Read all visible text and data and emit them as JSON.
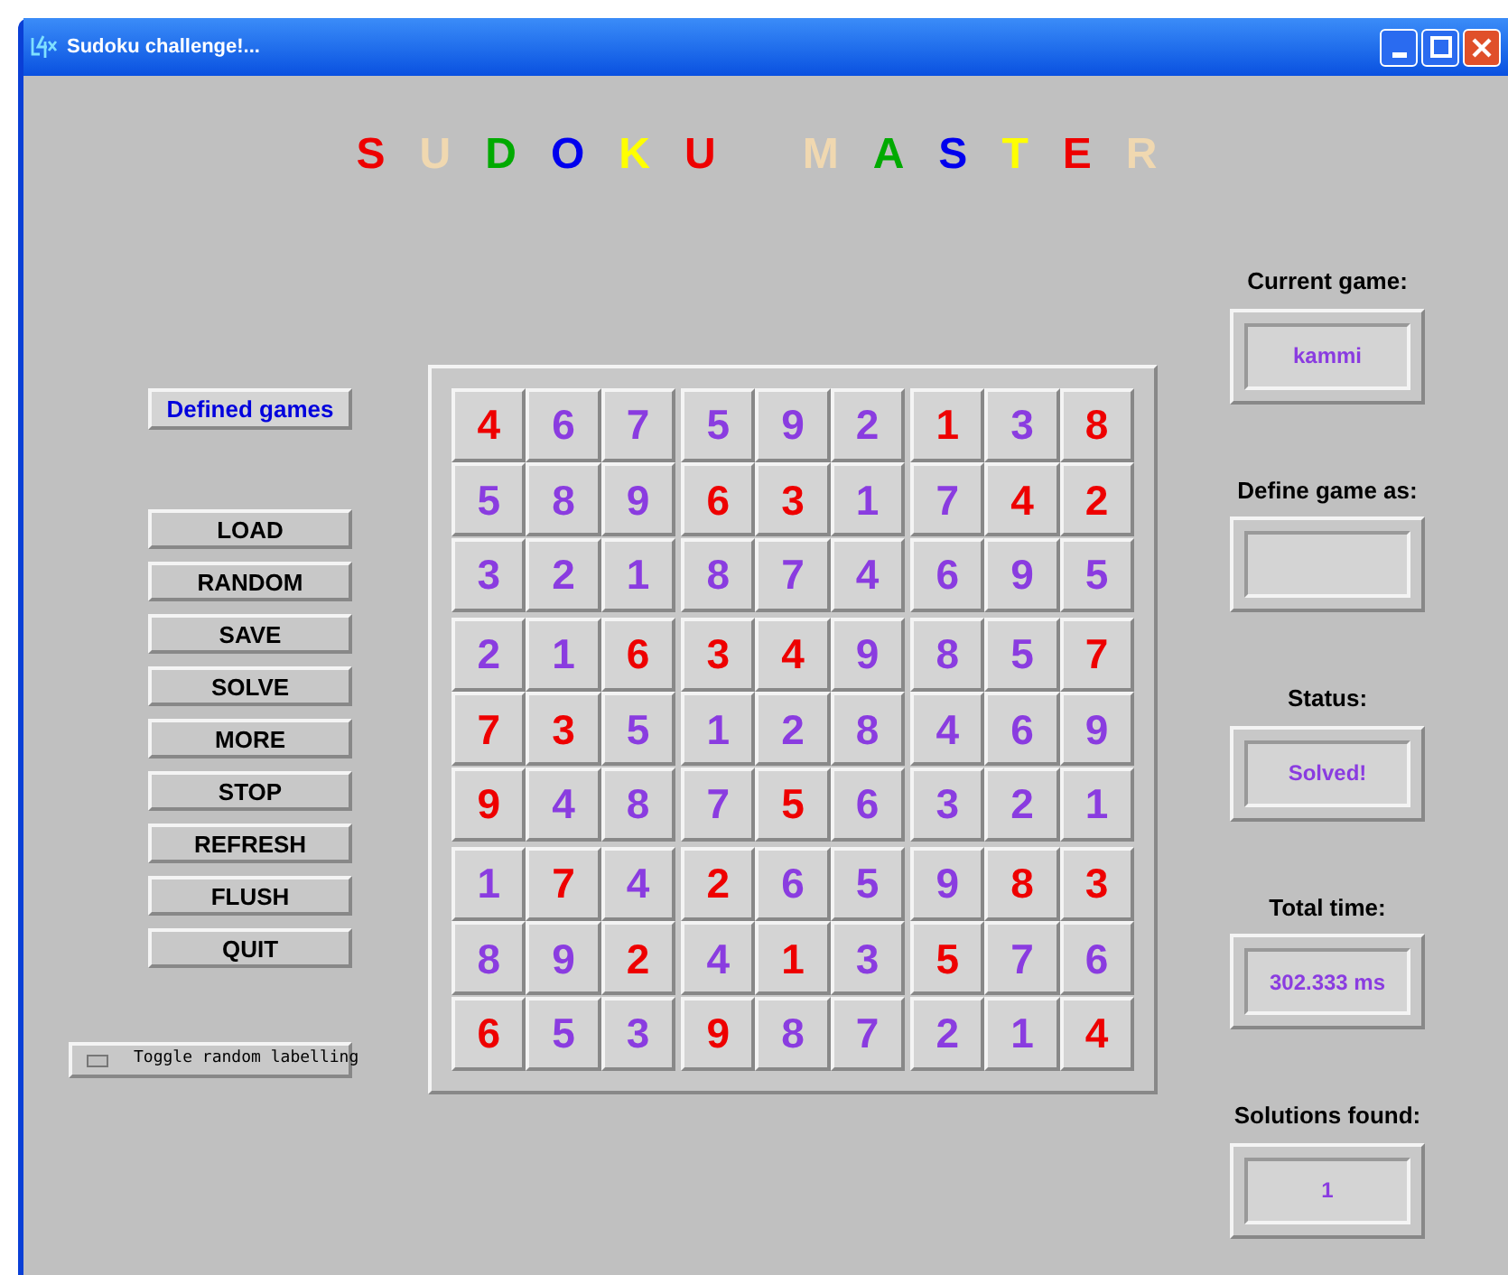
{
  "window": {
    "title": "Sudoku challenge!..."
  },
  "banner": {
    "words": [
      [
        {
          "letter": "S",
          "color": "#ee0000"
        },
        {
          "letter": "U",
          "color": "#f0d8b0"
        },
        {
          "letter": "D",
          "color": "#00aa00"
        },
        {
          "letter": "O",
          "color": "#0000ee"
        },
        {
          "letter": "K",
          "color": "#ffff00"
        },
        {
          "letter": "U",
          "color": "#ee0000"
        }
      ],
      [
        {
          "letter": "M",
          "color": "#f0d8b0"
        },
        {
          "letter": "A",
          "color": "#00aa00"
        },
        {
          "letter": "S",
          "color": "#0000ee"
        },
        {
          "letter": "T",
          "color": "#ffff00"
        },
        {
          "letter": "E",
          "color": "#ee0000"
        },
        {
          "letter": "R",
          "color": "#f0d8b0"
        }
      ]
    ]
  },
  "defined_games_button": "Defined games",
  "buttons": [
    "LOAD",
    "RANDOM",
    "SAVE",
    "SOLVE",
    "MORE",
    "STOP",
    "REFRESH",
    "FLUSH",
    "QUIT"
  ],
  "toggle": {
    "label": "Toggle random labelling",
    "checked": false
  },
  "grid": [
    [
      {
        "value": "4",
        "given": true
      },
      {
        "value": "6",
        "given": false
      },
      {
        "value": "7",
        "given": false
      },
      {
        "value": "5",
        "given": false
      },
      {
        "value": "9",
        "given": false
      },
      {
        "value": "2",
        "given": false
      },
      {
        "value": "1",
        "given": true
      },
      {
        "value": "3",
        "given": false
      },
      {
        "value": "8",
        "given": true
      }
    ],
    [
      {
        "value": "5",
        "given": false
      },
      {
        "value": "8",
        "given": false
      },
      {
        "value": "9",
        "given": false
      },
      {
        "value": "6",
        "given": true
      },
      {
        "value": "3",
        "given": true
      },
      {
        "value": "1",
        "given": false
      },
      {
        "value": "7",
        "given": false
      },
      {
        "value": "4",
        "given": true
      },
      {
        "value": "2",
        "given": true
      }
    ],
    [
      {
        "value": "3",
        "given": false
      },
      {
        "value": "2",
        "given": false
      },
      {
        "value": "1",
        "given": false
      },
      {
        "value": "8",
        "given": false
      },
      {
        "value": "7",
        "given": false
      },
      {
        "value": "4",
        "given": false
      },
      {
        "value": "6",
        "given": false
      },
      {
        "value": "9",
        "given": false
      },
      {
        "value": "5",
        "given": false
      }
    ],
    [
      {
        "value": "2",
        "given": false
      },
      {
        "value": "1",
        "given": false
      },
      {
        "value": "6",
        "given": true
      },
      {
        "value": "3",
        "given": true
      },
      {
        "value": "4",
        "given": true
      },
      {
        "value": "9",
        "given": false
      },
      {
        "value": "8",
        "given": false
      },
      {
        "value": "5",
        "given": false
      },
      {
        "value": "7",
        "given": true
      }
    ],
    [
      {
        "value": "7",
        "given": true
      },
      {
        "value": "3",
        "given": true
      },
      {
        "value": "5",
        "given": false
      },
      {
        "value": "1",
        "given": false
      },
      {
        "value": "2",
        "given": false
      },
      {
        "value": "8",
        "given": false
      },
      {
        "value": "4",
        "given": false
      },
      {
        "value": "6",
        "given": false
      },
      {
        "value": "9",
        "given": false
      }
    ],
    [
      {
        "value": "9",
        "given": true
      },
      {
        "value": "4",
        "given": false
      },
      {
        "value": "8",
        "given": false
      },
      {
        "value": "7",
        "given": false
      },
      {
        "value": "5",
        "given": true
      },
      {
        "value": "6",
        "given": false
      },
      {
        "value": "3",
        "given": false
      },
      {
        "value": "2",
        "given": false
      },
      {
        "value": "1",
        "given": false
      }
    ],
    [
      {
        "value": "1",
        "given": false
      },
      {
        "value": "7",
        "given": true
      },
      {
        "value": "4",
        "given": false
      },
      {
        "value": "2",
        "given": true
      },
      {
        "value": "6",
        "given": false
      },
      {
        "value": "5",
        "given": false
      },
      {
        "value": "9",
        "given": false
      },
      {
        "value": "8",
        "given": true
      },
      {
        "value": "3",
        "given": true
      }
    ],
    [
      {
        "value": "8",
        "given": false
      },
      {
        "value": "9",
        "given": false
      },
      {
        "value": "2",
        "given": true
      },
      {
        "value": "4",
        "given": false
      },
      {
        "value": "1",
        "given": true
      },
      {
        "value": "3",
        "given": false
      },
      {
        "value": "5",
        "given": true
      },
      {
        "value": "7",
        "given": false
      },
      {
        "value": "6",
        "given": false
      }
    ],
    [
      {
        "value": "6",
        "given": true
      },
      {
        "value": "5",
        "given": false
      },
      {
        "value": "3",
        "given": false
      },
      {
        "value": "9",
        "given": true
      },
      {
        "value": "8",
        "given": false
      },
      {
        "value": "7",
        "given": false
      },
      {
        "value": "2",
        "given": false
      },
      {
        "value": "1",
        "given": false
      },
      {
        "value": "4",
        "given": true
      }
    ]
  ],
  "info": [
    {
      "label": "Current game:",
      "kind": "display",
      "value": "kammi"
    },
    {
      "label": "Define game as:",
      "kind": "input"
    },
    {
      "label": "Status:",
      "kind": "display",
      "value": "Solved!"
    },
    {
      "label": "Total time:",
      "kind": "display",
      "value": "302.333 ms"
    },
    {
      "label": "Solutions found:",
      "kind": "display",
      "value": "1"
    }
  ]
}
